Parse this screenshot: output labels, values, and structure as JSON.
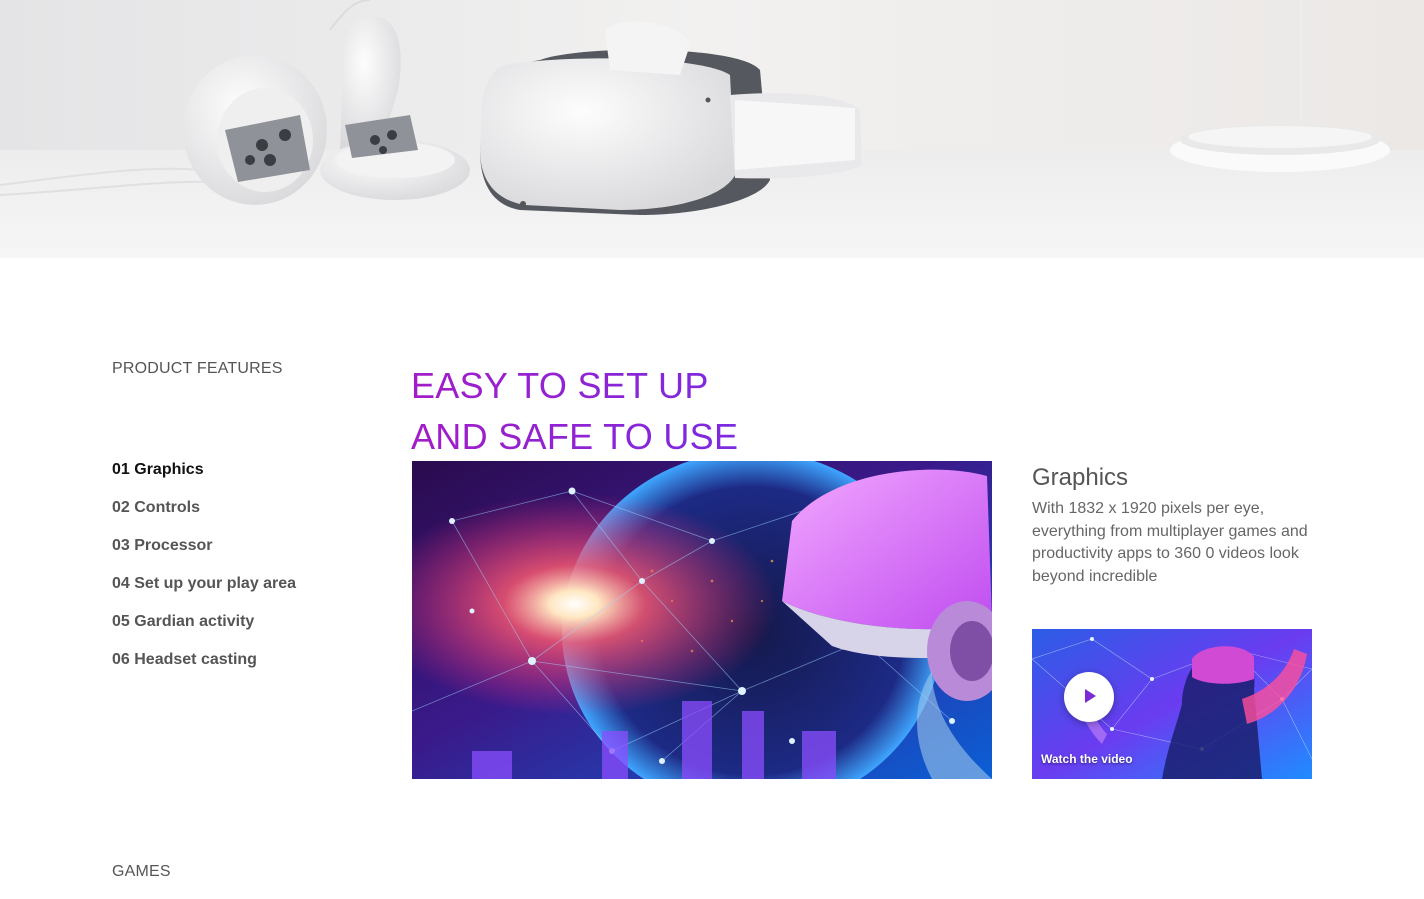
{
  "hero": {
    "image_name": "vr-headset-with-controllers"
  },
  "sidebar": {
    "label": "PRODUCT FEATURES",
    "items": [
      {
        "label": "01 Graphics",
        "active": true
      },
      {
        "label": "02 Controls",
        "active": false
      },
      {
        "label": "03 Processor",
        "active": false
      },
      {
        "label": "04 Set up your play area",
        "active": false
      },
      {
        "label": "05 Gardian activity",
        "active": false
      },
      {
        "label": "06 Headset casting",
        "active": false
      }
    ]
  },
  "main": {
    "headline_line1": "EASY TO SET UP",
    "headline_line2": "AND SAFE TO USE",
    "headline_colors": [
      "#a31cc7",
      "#7c2ae0"
    ],
    "image_name": "vr-digital-network-illustration"
  },
  "feature": {
    "title": "Graphics",
    "description": "With 1832 x 1920 pixels per eye, everything from multiplayer games and productivity apps to 360 0 videos look beyond incredible"
  },
  "video": {
    "label": "Watch the video",
    "icon": "play-icon",
    "accent": "#7b2bd6"
  },
  "games": {
    "label": "GAMES"
  }
}
